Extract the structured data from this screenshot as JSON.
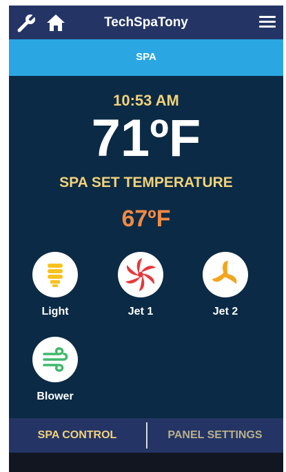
{
  "header": {
    "title": "TechSpaTony",
    "icons": [
      "wrench-icon",
      "home-icon",
      "hamburger-menu-icon"
    ],
    "color": "#243565"
  },
  "tabs": {
    "active_label": "SPA",
    "color": "#2aa6e3"
  },
  "status": {
    "time": "10:53 AM",
    "current_temperature": "71ºF",
    "set_label": "SPA SET TEMPERATURE",
    "set_temperature": "67ºF"
  },
  "devices": [
    {
      "label": "Light",
      "icon": "light-bulb-icon",
      "color": "#f6c21c"
    },
    {
      "label": "Jet 1",
      "icon": "jet-fan-icon",
      "color": "#e8373c"
    },
    {
      "label": "Jet 2",
      "icon": "jet-fan-icon",
      "color": "#f3a51e"
    },
    {
      "label": "Blower",
      "icon": "wind-icon",
      "color": "#3fb96a"
    }
  ],
  "bottom_nav": {
    "spa_control": "SPA CONTROL",
    "panel_settings": "PANEL SETTINGS"
  },
  "colors": {
    "background": "#0b2a45",
    "accent_yellow": "#f2d27a",
    "set_temp_orange": "#f08a45"
  }
}
